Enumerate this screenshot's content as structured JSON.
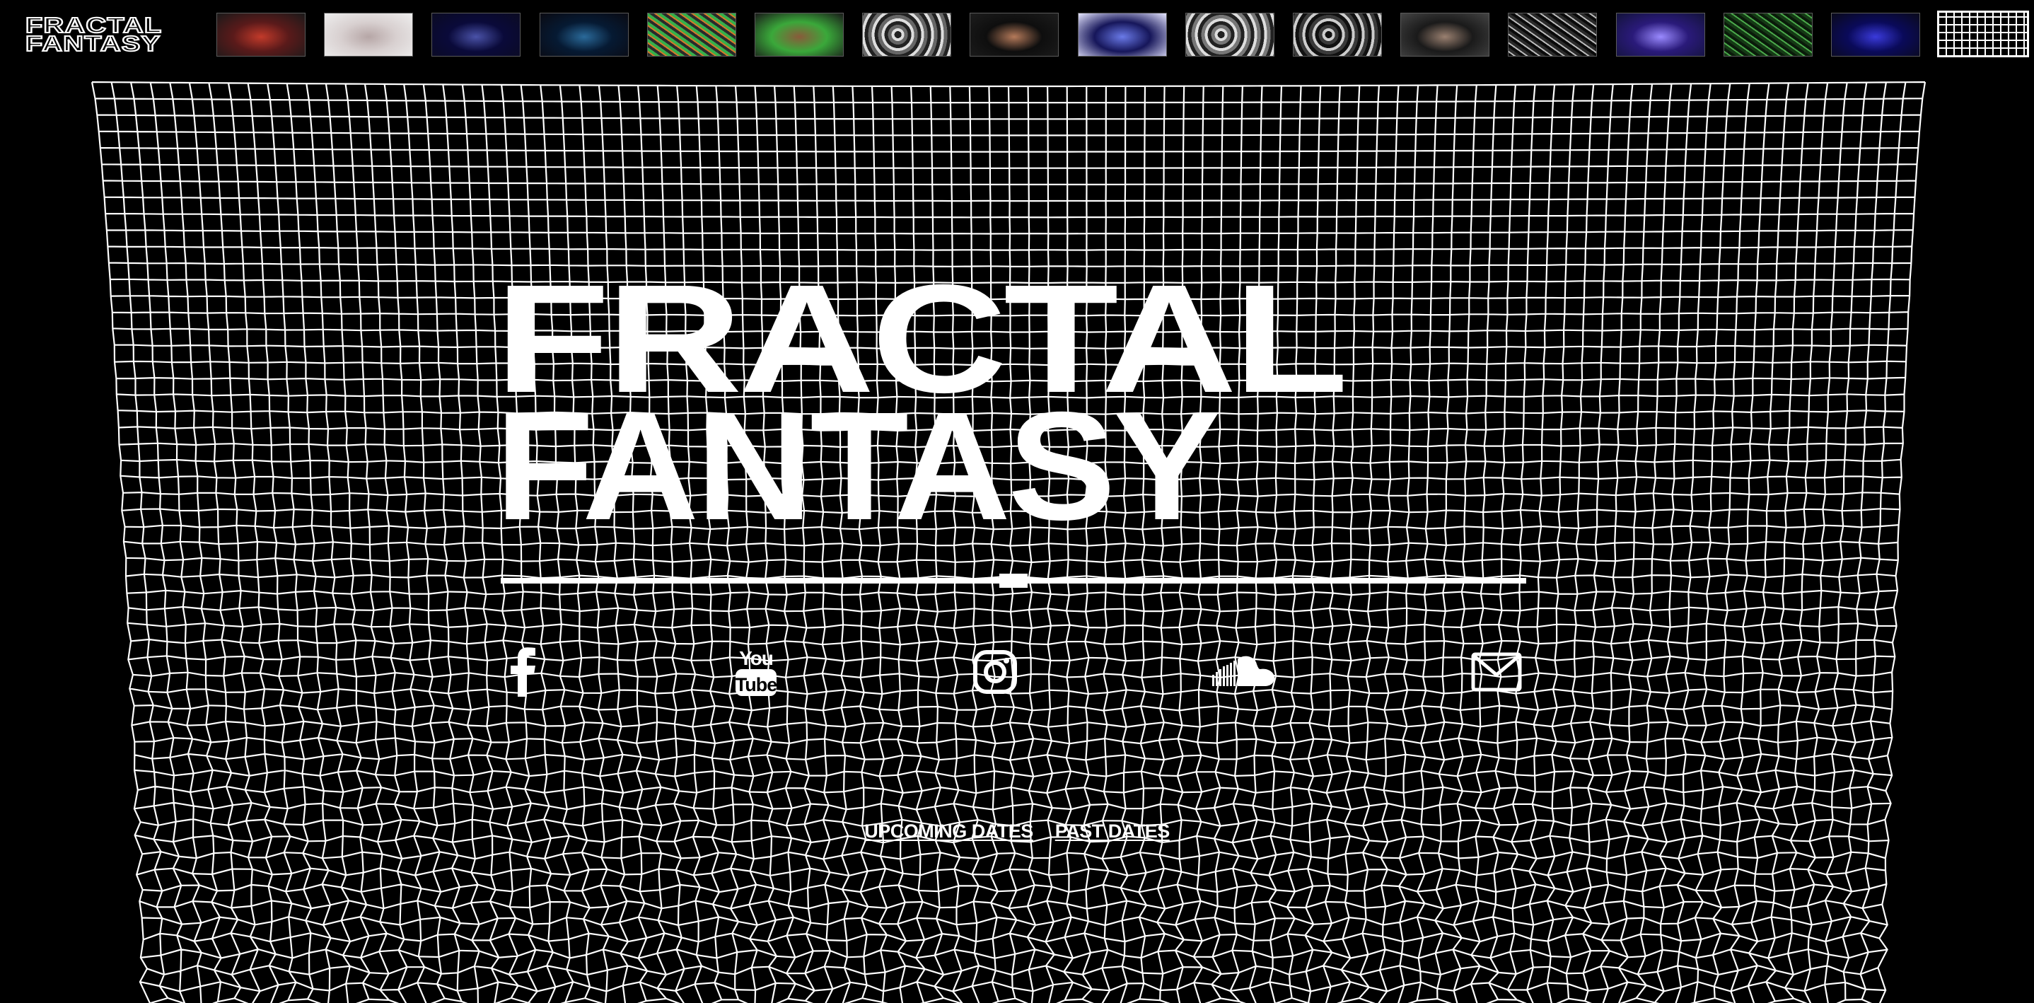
{
  "brand": {
    "logo_line_1": "FRACTAL",
    "logo_line_2": "FANTASY"
  },
  "hero": {
    "title_line_1": "FRACTAL",
    "title_line_2": "FANTASY",
    "progress": 0.5
  },
  "thumbnails": [
    {
      "name": "thumb-1",
      "colors": [
        "#5a1a1a",
        "#c23a2a",
        "#1a1a1a"
      ],
      "icon": "figure-grid"
    },
    {
      "name": "thumb-2",
      "colors": [
        "#d8d0d0",
        "#b6a6a6",
        "#eeeeee"
      ],
      "icon": "figure-light"
    },
    {
      "name": "thumb-3",
      "colors": [
        "#0a0a3a",
        "#4a52a8",
        "#0b0b22"
      ],
      "icon": "text-swoosh"
    },
    {
      "name": "thumb-4",
      "colors": [
        "#061a33",
        "#2a6a9a",
        "#0a0a12"
      ],
      "icon": "figure-blue"
    },
    {
      "name": "thumb-5",
      "colors": [
        "#2a2a2a",
        "#d47a2a",
        "#36b04a"
      ],
      "icon": "noise"
    },
    {
      "name": "thumb-6",
      "colors": [
        "#3aa83a",
        "#8a5a3a",
        "#1a1a1a"
      ],
      "icon": "portrait"
    },
    {
      "name": "thumb-7",
      "colors": [
        "#666666",
        "#dddddd",
        "#222222"
      ],
      "icon": "chrome"
    },
    {
      "name": "thumb-8",
      "colors": [
        "#0e0e0e",
        "#b57a5a",
        "#1d1d1d"
      ],
      "icon": "portrait-dark"
    },
    {
      "name": "thumb-9",
      "colors": [
        "#16165a",
        "#6a7ae8",
        "#e6e6ff"
      ],
      "icon": "sparkle"
    },
    {
      "name": "thumb-10",
      "colors": [
        "#777777",
        "#dddddd",
        "#222222"
      ],
      "icon": "chrome"
    },
    {
      "name": "thumb-11",
      "colors": [
        "#3a3a3a",
        "#cccccc",
        "#111111"
      ],
      "icon": "hands"
    },
    {
      "name": "thumb-12",
      "colors": [
        "#1a1a1a",
        "#9a8070",
        "#444444"
      ],
      "icon": "portrait-old"
    },
    {
      "name": "thumb-13",
      "colors": [
        "#0a0a0a",
        "#bbbbbb",
        "#2a2a2a"
      ],
      "icon": "particles"
    },
    {
      "name": "thumb-14",
      "colors": [
        "#2a1a7a",
        "#9a8aff",
        "#13133a"
      ],
      "icon": "crystal"
    },
    {
      "name": "thumb-15",
      "colors": [
        "#153a15",
        "#4aa84a",
        "#0a1a0a"
      ],
      "icon": "green-noise"
    },
    {
      "name": "thumb-16",
      "colors": [
        "#0a0a5a",
        "#3a3adb",
        "#0a0a1a"
      ],
      "icon": "blue-grid"
    },
    {
      "name": "thumb-17",
      "colors": [
        "#111111",
        "#eeeeee",
        "#000000"
      ],
      "icon": "grid-active",
      "active": true
    }
  ],
  "social": {
    "facebook": "facebook-icon",
    "youtube": "youtube-icon",
    "youtube_line_1": "You",
    "youtube_line_2": "Tube",
    "instagram": "instagram-icon",
    "soundcloud": "soundcloud-icon",
    "email": "email-icon"
  },
  "dates": {
    "upcoming": "UPCOMING DATES",
    "past": "PAST DATES"
  },
  "colors": {
    "background": "#000000",
    "foreground": "#ffffff",
    "grid": "#ffffff"
  }
}
